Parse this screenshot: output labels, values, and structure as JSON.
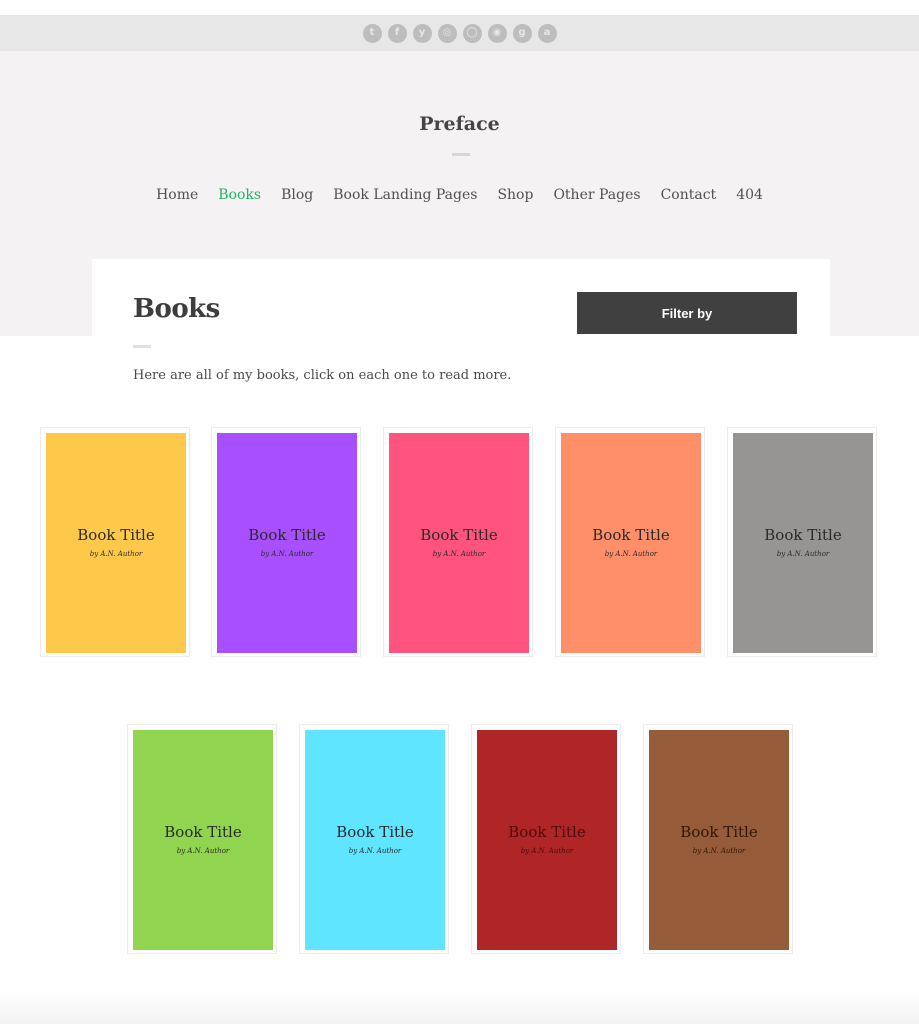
{
  "social": [
    {
      "name": "twitter-icon",
      "glyph": "t"
    },
    {
      "name": "facebook-icon",
      "glyph": "f"
    },
    {
      "name": "yammer-icon",
      "glyph": "y"
    },
    {
      "name": "dribbble-icon",
      "glyph": "◎"
    },
    {
      "name": "github-icon",
      "glyph": "◯"
    },
    {
      "name": "instagram-icon",
      "glyph": "◉"
    },
    {
      "name": "goodreads-icon",
      "glyph": "g"
    },
    {
      "name": "amazon-icon",
      "glyph": "a"
    }
  ],
  "site": {
    "title": "Preface"
  },
  "nav": {
    "items": [
      "Home",
      "Books",
      "Blog",
      "Book Landing Pages",
      "Shop",
      "Other Pages",
      "Contact",
      "404"
    ],
    "active_index": 1,
    "active_color": "#20b463"
  },
  "page": {
    "title": "Books",
    "filter_label": "Filter by",
    "intro": "Here are all of my books, click on each one to read more."
  },
  "books": [
    {
      "title": "Book Title",
      "author": "by A.N. Author",
      "color": "#fec94b"
    },
    {
      "title": "Book Title",
      "author": "by A.N. Author",
      "color": "#a84fff"
    },
    {
      "title": "Book Title",
      "author": "by A.N. Author",
      "color": "#fe547d"
    },
    {
      "title": "Book Title",
      "author": "by A.N. Author",
      "color": "#fe8f69"
    },
    {
      "title": "Book Title",
      "author": "by A.N. Author",
      "color": "#979593"
    },
    {
      "title": "Book Title",
      "author": "by A.N. Author",
      "color": "#90d44f"
    },
    {
      "title": "Book Title",
      "author": "by A.N. Author",
      "color": "#5fe5ff"
    },
    {
      "title": "Book Title",
      "author": "by A.N. Author",
      "color": "#b02525"
    },
    {
      "title": "Book Title",
      "author": "by A.N. Author",
      "color": "#965b38"
    }
  ]
}
